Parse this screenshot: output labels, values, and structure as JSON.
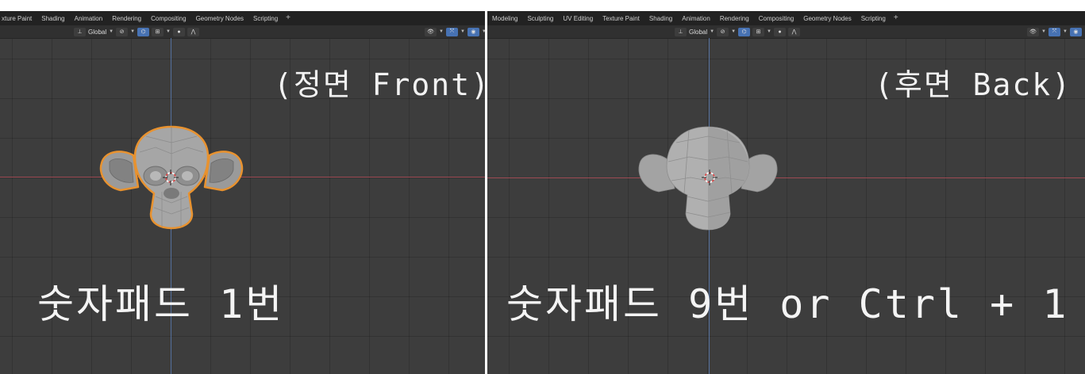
{
  "left_viewport": {
    "tabs": [
      "xture Paint",
      "Shading",
      "Animation",
      "Rendering",
      "Compositing",
      "Geometry Nodes",
      "Scripting"
    ],
    "add_tab": "+",
    "orientation_label": "Global",
    "view_label": "(정면 Front)",
    "shortcut_label": "숫자패드 1번"
  },
  "right_viewport": {
    "tabs": [
      "Modeling",
      "Sculpting",
      "UV Editing",
      "Texture Paint",
      "Shading",
      "Animation",
      "Rendering",
      "Compositing",
      "Geometry Nodes",
      "Scripting"
    ],
    "add_tab": "+",
    "orientation_label": "Global",
    "view_label": "(후면 Back)",
    "shortcut_label": "숫자패드 9번 or Ctrl + 1"
  },
  "colors": {
    "viewport_bg": "#3d3d3d",
    "selection_outline": "#e8922f",
    "axis_x": "#a84c56",
    "axis_y": "#5a7bb0",
    "active_tool": "#4772b3"
  }
}
